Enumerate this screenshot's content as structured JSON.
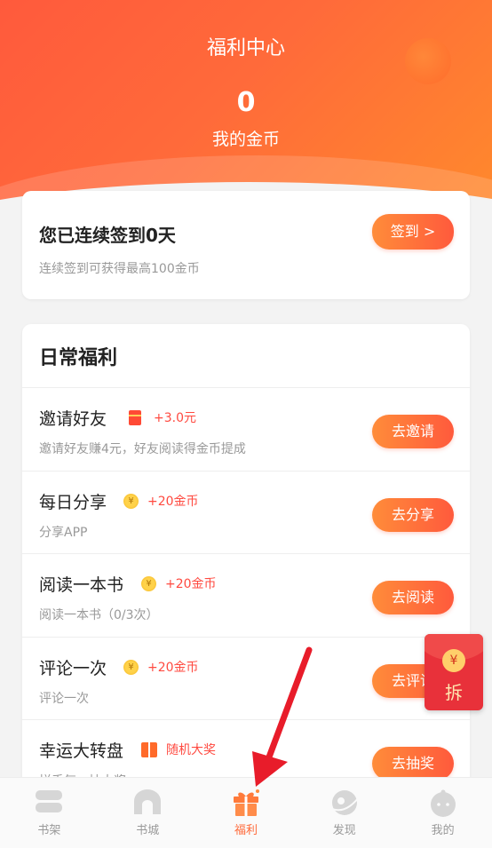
{
  "header": {
    "title": "福利中心",
    "coins": "0",
    "coins_label": "我的金币"
  },
  "signin": {
    "title": "您已连续签到0天",
    "subtitle": "连续签到可获得最高100金币",
    "button": "签到 >"
  },
  "daily": {
    "title": "日常福利",
    "tasks": [
      {
        "name": "邀请好友",
        "icon": "red-envelope-icon",
        "reward": "+3.0元",
        "desc": "邀请好友赚4元，好友阅读得金币提成",
        "button": "去邀请"
      },
      {
        "name": "每日分享",
        "icon": "coin-icon",
        "reward": "+20金币",
        "desc": "分享APP",
        "button": "去分享"
      },
      {
        "name": "阅读一本书",
        "icon": "coin-icon",
        "reward": "+20金币",
        "desc": "阅读一本书（0/3次）",
        "button": "去阅读"
      },
      {
        "name": "评论一次",
        "icon": "coin-icon",
        "reward": "+20金币",
        "desc": "评论一次",
        "button": "去评论"
      },
      {
        "name": "幸运大转盘",
        "icon": "gift-icon",
        "reward": "随机大奖",
        "desc": "拼手气，抽大奖",
        "button": "去抽奖"
      }
    ]
  },
  "red_packet": {
    "symbol": "¥",
    "label": "拆"
  },
  "tabbar": {
    "tabs": [
      {
        "label": "书架",
        "icon": "bookshelf-icon"
      },
      {
        "label": "书城",
        "icon": "bookstore-icon"
      },
      {
        "label": "福利",
        "icon": "gift-icon",
        "active": true
      },
      {
        "label": "发现",
        "icon": "discover-icon"
      },
      {
        "label": "我的",
        "icon": "profile-icon"
      }
    ]
  },
  "colors": {
    "accent": "#ff5a3c",
    "accent_light": "#ff8c3a",
    "reward_text": "#ff4a40",
    "annotation_arrow": "#e81c2a"
  }
}
